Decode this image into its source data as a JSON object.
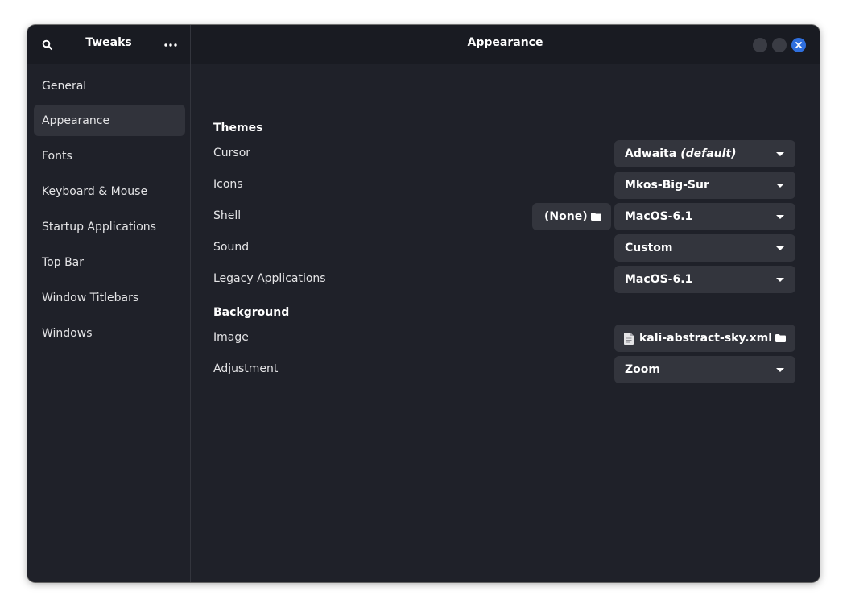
{
  "sidebar_header": {
    "title": "Tweaks",
    "search_icon": "search-icon",
    "menu_icon": "more-icon"
  },
  "header": {
    "title": "Appearance"
  },
  "sidebar": {
    "items": [
      {
        "label": "General"
      },
      {
        "label": "Appearance"
      },
      {
        "label": "Fonts"
      },
      {
        "label": "Keyboard & Mouse"
      },
      {
        "label": "Startup Applications"
      },
      {
        "label": "Top Bar"
      },
      {
        "label": "Window Titlebars"
      },
      {
        "label": "Windows"
      }
    ],
    "active_index": 1
  },
  "themes": {
    "title": "Themes",
    "cursor": {
      "label": "Cursor",
      "value": "Adwaita",
      "note": "(default)"
    },
    "icons": {
      "label": "Icons",
      "value": "Mkos-Big-Sur"
    },
    "shell": {
      "label": "Shell",
      "file_value": "(None)",
      "value": "MacOS-6.1"
    },
    "sound": {
      "label": "Sound",
      "value": "Custom"
    },
    "legacy": {
      "label": "Legacy Applications",
      "value": "MacOS-6.1"
    }
  },
  "background": {
    "title": "Background",
    "image": {
      "label": "Image",
      "value": "kali-abstract-sky.xml"
    },
    "adjustment": {
      "label": "Adjustment",
      "value": "Zoom"
    }
  },
  "colors": {
    "window_bg": "#1f2129",
    "titlebar_bg": "#191b22",
    "control_bg": "#33353d",
    "close_accent": "#2f6fde"
  }
}
